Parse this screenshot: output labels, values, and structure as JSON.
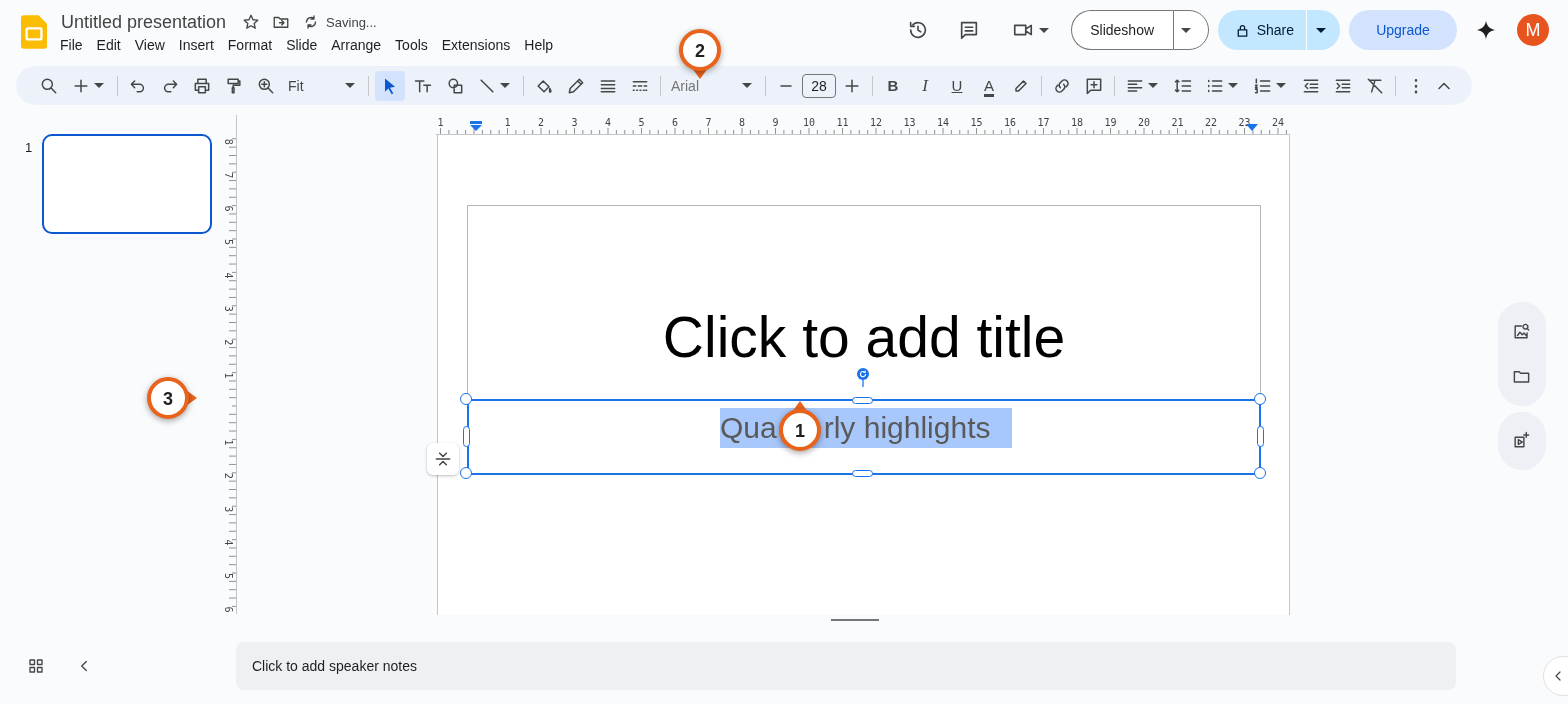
{
  "document": {
    "title": "Untitled presentation",
    "save_status": "Saving..."
  },
  "menu": [
    "File",
    "Edit",
    "View",
    "Insert",
    "Format",
    "Slide",
    "Arrange",
    "Tools",
    "Extensions",
    "Help"
  ],
  "header_buttons": {
    "slideshow": "Slideshow",
    "share": "Share",
    "upgrade": "Upgrade",
    "avatar": "M"
  },
  "toolbar": {
    "zoom": "Fit",
    "pointer_selected": true,
    "font": "Arial",
    "font_size": "28",
    "text_style": [
      "B",
      "I",
      "U"
    ],
    "text_color": "A"
  },
  "horizontal_ruler": [
    "1",
    "1",
    "2",
    "3",
    "4",
    "5",
    "6",
    "7",
    "8",
    "9",
    "10",
    "11",
    "12",
    "13",
    "14",
    "15",
    "16",
    "17",
    "18",
    "19",
    "20",
    "21",
    "22",
    "23",
    "24"
  ],
  "vertical_ruler": [
    "8",
    "7",
    "6",
    "5",
    "4",
    "3",
    "2",
    "1",
    "1",
    "2",
    "3",
    "4",
    "5",
    "6"
  ],
  "filmstrip": [
    {
      "number": "1",
      "selected": true
    }
  ],
  "slide": {
    "title_placeholder": "Click to add title",
    "subtitle_parts": [
      "Qua",
      "rly highlights"
    ],
    "subtitle_selected": true
  },
  "speaker_notes": {
    "placeholder": "Click to add speaker notes"
  },
  "callouts": [
    {
      "label": "1",
      "kind": "up"
    },
    {
      "label": "2",
      "kind": "down"
    },
    {
      "label": "3",
      "kind": "right"
    }
  ]
}
